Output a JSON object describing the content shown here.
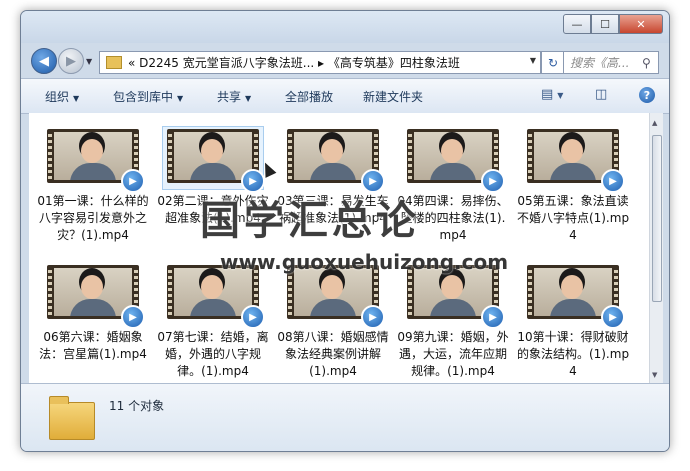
{
  "window": {
    "buttons": {
      "minimize": "—",
      "maximize": "☐",
      "close": "✕"
    }
  },
  "nav": {
    "back_icon": "back-arrow-icon",
    "forward_icon": "forward-arrow-icon",
    "address_path": "«  D2245 宽元堂盲派八字象法班...  ▸  《高专筑基》四柱象法班",
    "search_placeholder": "搜索《高..."
  },
  "toolbar": {
    "organize": "组织",
    "include_in_library": "包含到库中",
    "share": "共享",
    "play_all": "全部播放",
    "new_folder": "新建文件夹"
  },
  "files": [
    {
      "name": "01第一课：什么样的八字容易引发意外之灾？(1).mp4",
      "selected": false
    },
    {
      "name": "02第二课：意外伤灾超准象法(1).mp4",
      "selected": true
    },
    {
      "name": "03第三课：易发生车祸超准象法(1).mp4",
      "selected": false
    },
    {
      "name": "04第四课：易摔伤、坠楼的四柱象法(1).mp4",
      "selected": false
    },
    {
      "name": "05第五课：象法直读不婚八字特点(1).mp4",
      "selected": false
    },
    {
      "name": "06第六课：婚姻象法：宫星篇(1).mp4",
      "selected": false
    },
    {
      "name": "07第七课：结婚，离婚，外遇的八字规律。(1).mp4",
      "selected": false
    },
    {
      "name": "08第八课：婚姻感情象法经典案例讲解(1).mp4",
      "selected": false
    },
    {
      "name": "09第九课：婚姻，外遇，大运，流年应期规律。(1).mp4",
      "selected": false
    },
    {
      "name": "10第十课：得财破财的象法结构。(1).mp4",
      "selected": false
    }
  ],
  "status": {
    "count": "11 个对象"
  },
  "watermark": {
    "text": "国学汇总论",
    "url": "www.guoxuehuizong.com"
  }
}
